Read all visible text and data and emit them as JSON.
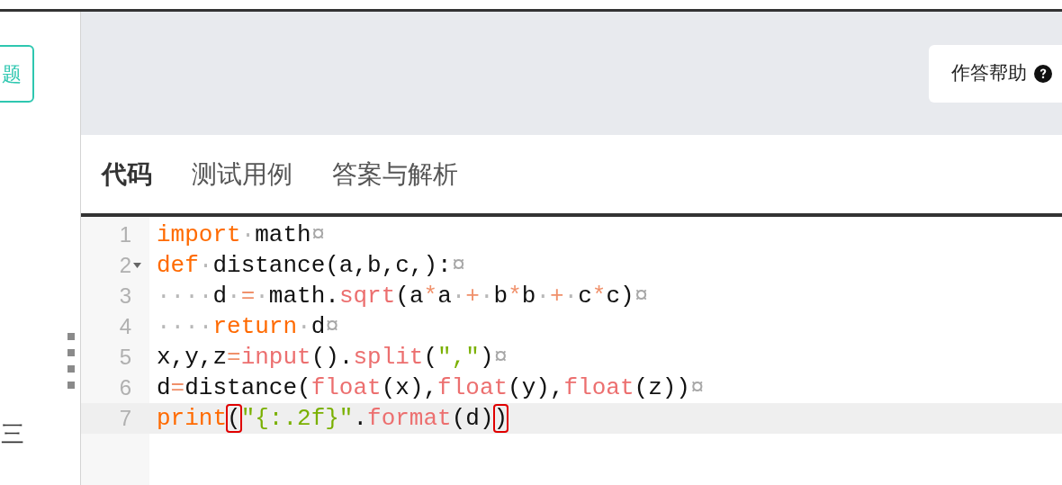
{
  "sidebar": {
    "button_label": "题",
    "text": "三"
  },
  "help_button": {
    "label": "作答帮助"
  },
  "tabs": [
    {
      "label": "代码",
      "selected": true
    },
    {
      "label": "测试用例",
      "selected": false
    },
    {
      "label": "答案与解析",
      "selected": false
    }
  ],
  "editor": {
    "lines": [
      {
        "number": "1",
        "foldable": false,
        "current": false,
        "tokens": [
          {
            "kind": "keyword",
            "text": "import"
          },
          {
            "kind": "space",
            "text": "·"
          },
          {
            "kind": "plain",
            "text": "math"
          },
          {
            "kind": "eol",
            "text": "¤"
          }
        ]
      },
      {
        "number": "2",
        "foldable": true,
        "current": false,
        "tokens": [
          {
            "kind": "keyword",
            "text": "def"
          },
          {
            "kind": "space",
            "text": "·"
          },
          {
            "kind": "plain",
            "text": "distance(a,b,c,):"
          },
          {
            "kind": "eol",
            "text": "¤"
          }
        ]
      },
      {
        "number": "3",
        "foldable": false,
        "current": false,
        "tokens": [
          {
            "kind": "space",
            "text": "····"
          },
          {
            "kind": "plain",
            "text": "d"
          },
          {
            "kind": "space",
            "text": "·"
          },
          {
            "kind": "operator",
            "text": "="
          },
          {
            "kind": "space",
            "text": "·"
          },
          {
            "kind": "plain",
            "text": "math."
          },
          {
            "kind": "builtin",
            "text": "sqrt"
          },
          {
            "kind": "plain",
            "text": "(a"
          },
          {
            "kind": "operator",
            "text": "*"
          },
          {
            "kind": "plain",
            "text": "a"
          },
          {
            "kind": "space",
            "text": "·"
          },
          {
            "kind": "operator",
            "text": "+"
          },
          {
            "kind": "space",
            "text": "·"
          },
          {
            "kind": "plain",
            "text": "b"
          },
          {
            "kind": "operator",
            "text": "*"
          },
          {
            "kind": "plain",
            "text": "b"
          },
          {
            "kind": "space",
            "text": "·"
          },
          {
            "kind": "operator",
            "text": "+"
          },
          {
            "kind": "space",
            "text": "·"
          },
          {
            "kind": "plain",
            "text": "c"
          },
          {
            "kind": "operator",
            "text": "*"
          },
          {
            "kind": "plain",
            "text": "c)"
          },
          {
            "kind": "eol",
            "text": "¤"
          }
        ]
      },
      {
        "number": "4",
        "foldable": false,
        "current": false,
        "tokens": [
          {
            "kind": "space",
            "text": "····"
          },
          {
            "kind": "keyword",
            "text": "return"
          },
          {
            "kind": "space",
            "text": "·"
          },
          {
            "kind": "plain",
            "text": "d"
          },
          {
            "kind": "eol",
            "text": "¤"
          }
        ]
      },
      {
        "number": "5",
        "foldable": false,
        "current": false,
        "tokens": [
          {
            "kind": "plain",
            "text": "x,y,z"
          },
          {
            "kind": "operator",
            "text": "="
          },
          {
            "kind": "builtin",
            "text": "input"
          },
          {
            "kind": "plain",
            "text": "()."
          },
          {
            "kind": "builtin",
            "text": "split"
          },
          {
            "kind": "plain",
            "text": "("
          },
          {
            "kind": "string",
            "text": "\",\""
          },
          {
            "kind": "plain",
            "text": ")"
          },
          {
            "kind": "eol",
            "text": "¤"
          }
        ]
      },
      {
        "number": "6",
        "foldable": false,
        "current": false,
        "tokens": [
          {
            "kind": "plain",
            "text": "d"
          },
          {
            "kind": "operator",
            "text": "="
          },
          {
            "kind": "plain",
            "text": "distance("
          },
          {
            "kind": "builtin",
            "text": "float"
          },
          {
            "kind": "plain",
            "text": "(x),"
          },
          {
            "kind": "builtin",
            "text": "float"
          },
          {
            "kind": "plain",
            "text": "(y),"
          },
          {
            "kind": "builtin",
            "text": "float"
          },
          {
            "kind": "plain",
            "text": "(z))"
          },
          {
            "kind": "eol",
            "text": "¤"
          }
        ]
      },
      {
        "number": "7",
        "foldable": false,
        "current": true,
        "tokens": [
          {
            "kind": "keyword",
            "text": "print"
          },
          {
            "kind": "match",
            "text": "("
          },
          {
            "kind": "string",
            "text": "\"{:.2f}\""
          },
          {
            "kind": "plain",
            "text": "."
          },
          {
            "kind": "builtin",
            "text": "format"
          },
          {
            "kind": "plain",
            "text": "(d)"
          },
          {
            "kind": "match",
            "text": ")"
          }
        ]
      }
    ]
  }
}
